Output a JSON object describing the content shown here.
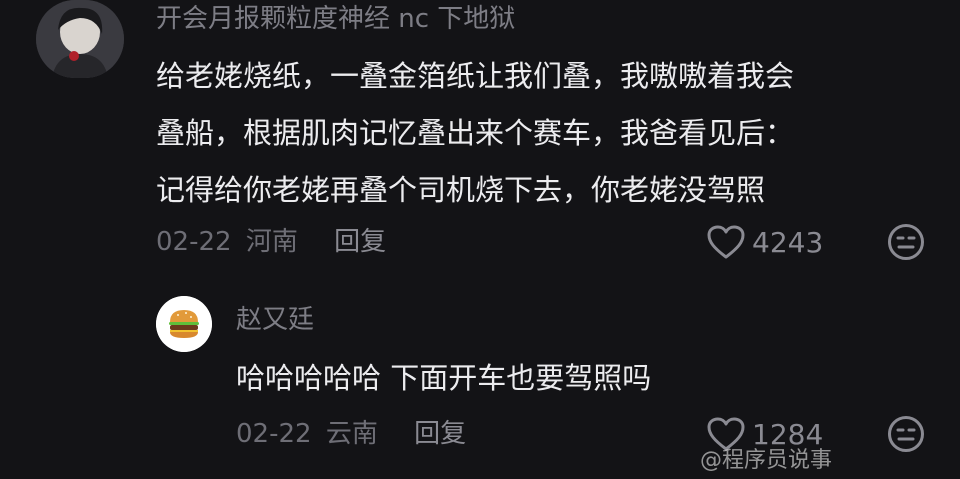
{
  "comment": {
    "username": "开会月报颗粒度神经 nc 下地狱",
    "lines": [
      "给老姥烧纸，一叠金箔纸让我们叠，我嗷嗷着我会",
      "叠船，根据肌肉记忆叠出来个赛车，我爸看见后：",
      "记得给你老姥再叠个司机烧下去，你老姥没驾照"
    ],
    "date": "02-22",
    "location": "河南",
    "reply_label": "回复",
    "like_count": "4243",
    "avatar_icon": "anime-avatar-icon"
  },
  "reply": {
    "username": "赵又廷",
    "text": "哈哈哈哈哈 下面开车也要驾照吗",
    "date": "02-22",
    "location": "云南",
    "reply_label": "回复",
    "like_count": "1284",
    "avatar_icon": "burger-icon"
  },
  "watermark": "@程序员说事"
}
